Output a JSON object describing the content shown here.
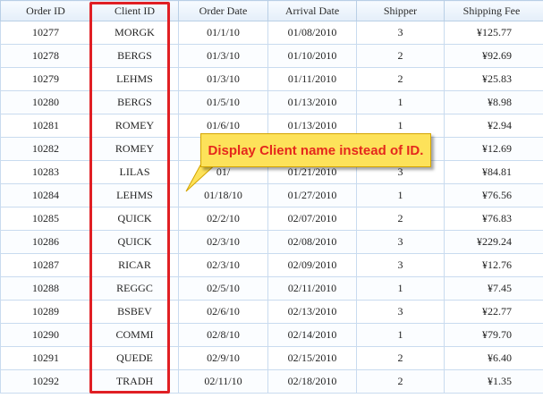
{
  "table": {
    "columns": [
      "Order ID",
      "Client ID",
      "Order Date",
      "Arrival Date",
      "Shipper",
      "Shipping Fee"
    ],
    "rows": [
      [
        "10277",
        "MORGK",
        "01/1/10",
        "01/08/2010",
        "3",
        "¥125.77"
      ],
      [
        "10278",
        "BERGS",
        "01/3/10",
        "01/10/2010",
        "2",
        "¥92.69"
      ],
      [
        "10279",
        "LEHMS",
        "01/3/10",
        "01/11/2010",
        "2",
        "¥25.83"
      ],
      [
        "10280",
        "BERGS",
        "01/5/10",
        "01/13/2010",
        "1",
        "¥8.98"
      ],
      [
        "10281",
        "ROMEY",
        "01/6/10",
        "01/13/2010",
        "1",
        "¥2.94"
      ],
      [
        "10282",
        "ROMEY",
        "",
        "",
        "",
        "¥12.69"
      ],
      [
        "10283",
        "LILAS",
        "01/",
        "01/21/2010",
        "3",
        "¥84.81"
      ],
      [
        "10284",
        "LEHMS",
        "01/18/10",
        "01/27/2010",
        "1",
        "¥76.56"
      ],
      [
        "10285",
        "QUICK",
        "02/2/10",
        "02/07/2010",
        "2",
        "¥76.83"
      ],
      [
        "10286",
        "QUICK",
        "02/3/10",
        "02/08/2010",
        "3",
        "¥229.24"
      ],
      [
        "10287",
        "RICAR",
        "02/3/10",
        "02/09/2010",
        "3",
        "¥12.76"
      ],
      [
        "10288",
        "REGGC",
        "02/5/10",
        "02/11/2010",
        "1",
        "¥7.45"
      ],
      [
        "10289",
        "BSBEV",
        "02/6/10",
        "02/13/2010",
        "3",
        "¥22.77"
      ],
      [
        "10290",
        "COMMI",
        "02/8/10",
        "02/14/2010",
        "1",
        "¥79.70"
      ],
      [
        "10291",
        "QUEDE",
        "02/9/10",
        "02/15/2010",
        "2",
        "¥6.40"
      ],
      [
        "10292",
        "TRADH",
        "02/11/10",
        "02/18/2010",
        "2",
        "¥1.35"
      ]
    ]
  },
  "annotation": {
    "callout_text": "Display Client name instead of ID.",
    "callout_color": "#fde25a",
    "text_color": "#e5281c",
    "highlight_color": "#e01f24"
  }
}
